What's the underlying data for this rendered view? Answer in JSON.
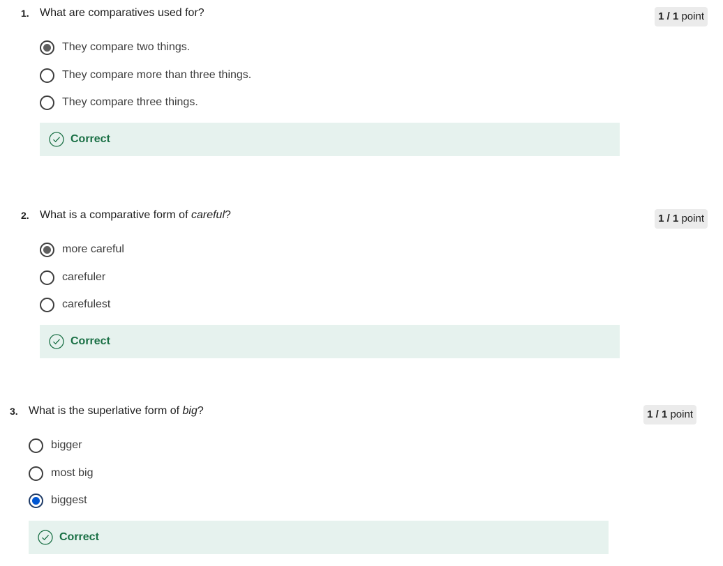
{
  "questions": [
    {
      "number": "1.",
      "text_before": "What are comparatives used for?",
      "text_italic": "",
      "text_after": "",
      "points_score": "1 / 1",
      "points_label": "point",
      "options": [
        {
          "label": "They compare two things.",
          "selected": true
        },
        {
          "label": "They compare more than three things.",
          "selected": false
        },
        {
          "label": "They compare three things.",
          "selected": false
        }
      ],
      "feedback": "Correct"
    },
    {
      "number": "2.",
      "text_before": "What is a comparative form of ",
      "text_italic": "careful",
      "text_after": "?",
      "points_score": "1 / 1",
      "points_label": "point",
      "options": [
        {
          "label": "more careful",
          "selected": true
        },
        {
          "label": "carefuler",
          "selected": false
        },
        {
          "label": "carefulest",
          "selected": false
        }
      ],
      "feedback": "Correct"
    },
    {
      "number": "3.",
      "text_before": "What is the superlative form of ",
      "text_italic": "big",
      "text_after": "?",
      "points_score": "1 / 1",
      "points_label": "point",
      "options": [
        {
          "label": "bigger",
          "selected": false
        },
        {
          "label": "most big",
          "selected": false
        },
        {
          "label": "biggest",
          "selected": true
        }
      ],
      "feedback": "Correct"
    }
  ],
  "colors": {
    "correct_text": "#1a7045",
    "correct_bg": "#e6f2ee",
    "points_bg": "#ebebeb",
    "selected_blue": "#0056d2"
  }
}
